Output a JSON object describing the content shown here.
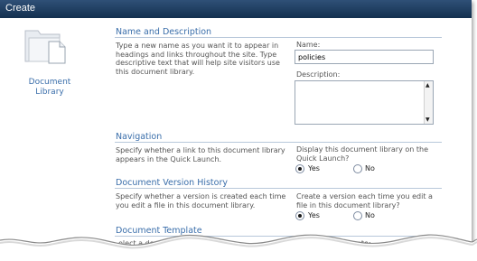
{
  "window": {
    "title": "Create"
  },
  "left": {
    "icon": "document-library-icon",
    "label_line1": "Document",
    "label_line2": "Library"
  },
  "name_section": {
    "heading": "Name and Description",
    "description": "Type a new name as you want it to appear in headings and links throughout the site. Type descriptive text that will help site visitors use this document library.",
    "name_label": "Name:",
    "name_value": "policies",
    "description_label": "Description:",
    "description_value": ""
  },
  "navigation": {
    "heading": "Navigation",
    "description": "Specify whether a link to this document library appears in the Quick Launch.",
    "question": "Display this document library on the Quick Launch?",
    "yes_label": "Yes",
    "no_label": "No",
    "selected": "Yes"
  },
  "version_history": {
    "heading": "Document Version History",
    "description": "Specify whether a version is created each time you edit a file in this document library.",
    "question": "Create a version each time you edit a file in this document library?",
    "yes_label": "Yes",
    "no_label": "No",
    "selected": "Yes"
  },
  "template": {
    "heading": "Document Template",
    "description_partial": "elect a document template to",
    "right_partial": "ate:"
  },
  "colors": {
    "accent": "#3a6eaa",
    "titlebar": "#1f3d62"
  }
}
